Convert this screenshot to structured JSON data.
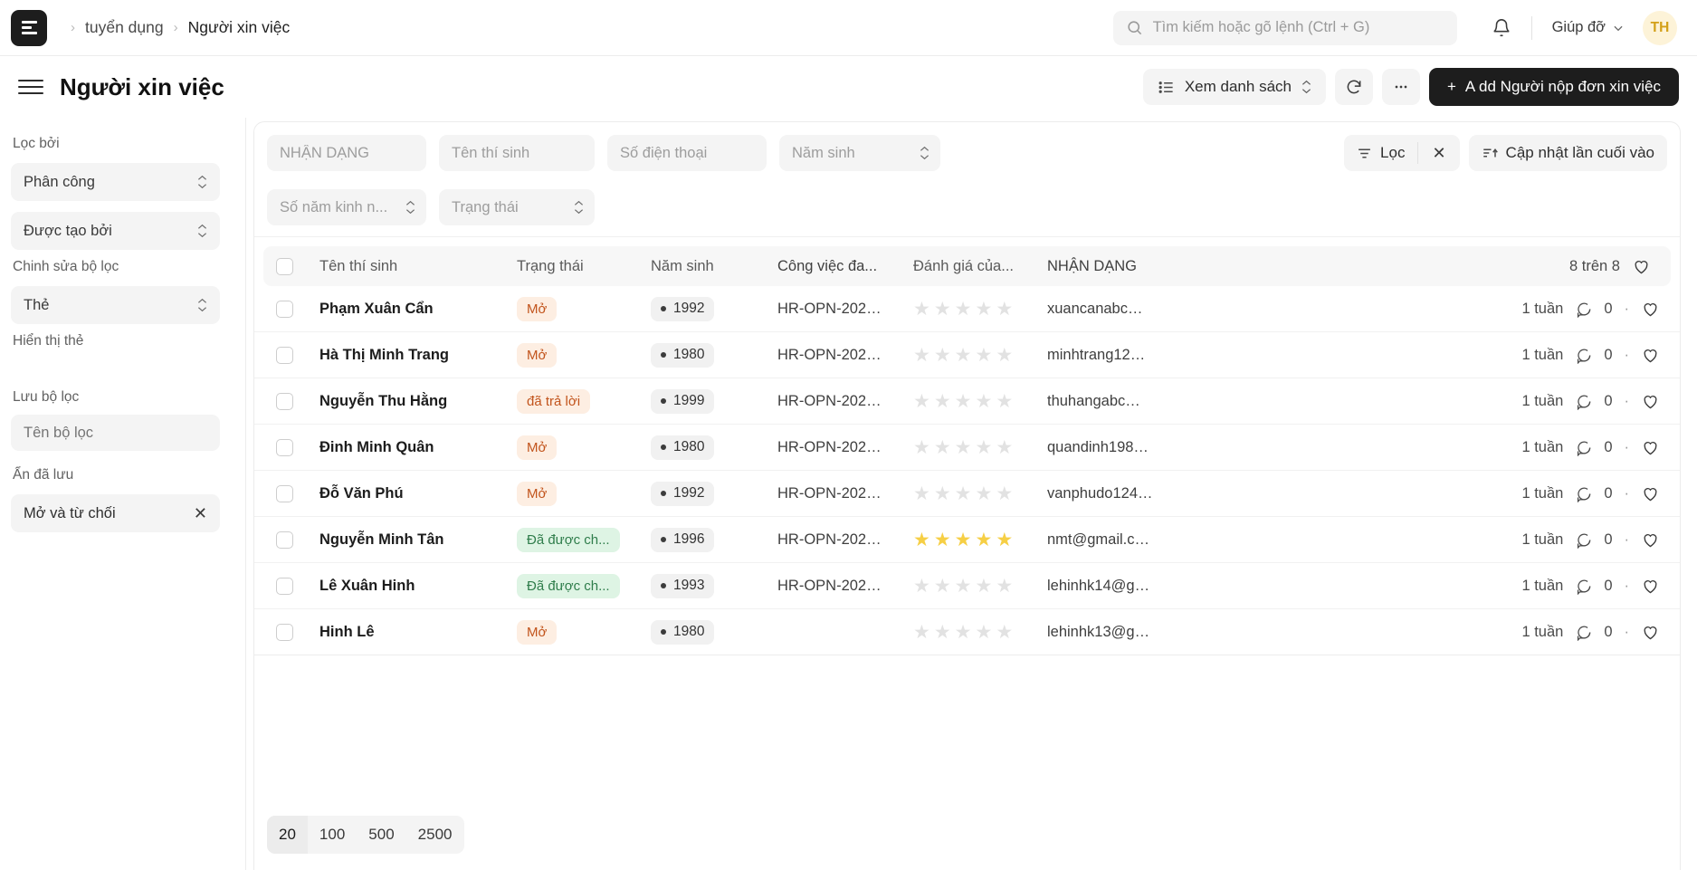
{
  "navbar": {
    "logo_alt": "frappe-logo",
    "breadcrumb": [
      {
        "label": "tuyển dụng"
      },
      {
        "label": "Người xin việc"
      }
    ],
    "search_placeholder": "Tìm kiếm hoặc gõ lệnh (Ctrl + G)",
    "help_label": "Giúp đỡ",
    "avatar_initials": "TH"
  },
  "page_header": {
    "title": "Người xin việc",
    "view_label": "Xem danh sách",
    "add_button": "A dd Người nộp đơn xin việc",
    "add_plus": "+"
  },
  "sidebar": {
    "filter_by_label": "Lọc bởi",
    "assigned_label": "Phân công",
    "created_by_label": "Được tạo bởi",
    "edit_filters_label": "Chinh sửa bộ lọc",
    "tag_label": "Thẻ",
    "show_tags_label": "Hiển thị thẻ",
    "save_filter_label": "Lưu bộ lọc",
    "filter_name_placeholder": "Tên bộ lọc",
    "saved_hidden_label": "Ẩn đã lưu",
    "saved_filter_chip": "Mở và từ chối"
  },
  "filters": {
    "id_placeholder": "NHẬN DẠNG",
    "name_placeholder": "Tên thí sinh",
    "phone_placeholder": "Số điện thoại",
    "year_placeholder": "Năm sinh",
    "experience_placeholder": "Số năm kinh n...",
    "status_placeholder": "Trạng thái",
    "filter_button": "Lọc",
    "clear_button": "✕",
    "sort_button": "Cập nhật lần cuối vào"
  },
  "table": {
    "columns": {
      "name": "Tên thí sinh",
      "status": "Trạng thái",
      "year": "Năm sinh",
      "job": "Công việc đa...",
      "rating": "Đánh giá của...",
      "id": "NHẬN DẠNG"
    },
    "count_label": "8 trên 8",
    "rows": [
      {
        "name": "Phạm Xuân Cẩn",
        "status": "Mở",
        "status_type": "open",
        "year": "1992",
        "job": "HR-OPN-202…",
        "rating": 0,
        "id": "xuancanabc…",
        "updated": "1 tuần",
        "comments": "0"
      },
      {
        "name": "Hà Thị Minh Trang",
        "status": "Mở",
        "status_type": "open",
        "year": "1980",
        "job": "HR-OPN-202…",
        "rating": 0,
        "id": "minhtrang12…",
        "updated": "1 tuần",
        "comments": "0"
      },
      {
        "name": "Nguyễn Thu Hằng",
        "status": "đã trả lời",
        "status_type": "replied",
        "year": "1999",
        "job": "HR-OPN-202…",
        "rating": 0,
        "id": "thuhangabc…",
        "updated": "1 tuần",
        "comments": "0"
      },
      {
        "name": "Đinh Minh Quân",
        "status": "Mở",
        "status_type": "open",
        "year": "1980",
        "job": "HR-OPN-202…",
        "rating": 0,
        "id": "quandinh198…",
        "updated": "1 tuần",
        "comments": "0"
      },
      {
        "name": "Đỗ Văn Phú",
        "status": "Mở",
        "status_type": "open",
        "year": "1992",
        "job": "HR-OPN-202…",
        "rating": 0,
        "id": "vanphudo124…",
        "updated": "1 tuần",
        "comments": "0"
      },
      {
        "name": "Nguyễn Minh Tân",
        "status": "Đã được ch...",
        "status_type": "accepted",
        "year": "1996",
        "job": "HR-OPN-202…",
        "rating": 5,
        "id": "nmt@gmail.c…",
        "updated": "1 tuần",
        "comments": "0"
      },
      {
        "name": "Lê Xuân Hinh",
        "status": "Đã được ch...",
        "status_type": "accepted",
        "year": "1993",
        "job": "HR-OPN-202…",
        "rating": 0,
        "id": "lehinhk14@g…",
        "updated": "1 tuần",
        "comments": "0"
      },
      {
        "name": "Hinh Lê",
        "status": "Mở",
        "status_type": "open",
        "year": "1980",
        "job": "",
        "rating": 0,
        "id": "lehinhk13@g…",
        "updated": "1 tuần",
        "comments": "0"
      }
    ]
  },
  "pagination": {
    "options": [
      "20",
      "100",
      "500",
      "2500"
    ],
    "active": "20"
  },
  "colors": {
    "accent_dark": "#1d1d1d",
    "status_open_bg": "#fdeee2",
    "status_open_fg": "#c2541c",
    "status_accepted_bg": "#def4e4",
    "status_accepted_fg": "#2f7d4b",
    "star_filled": "#f6cf45",
    "avatar_bg": "#fdf3d8"
  }
}
